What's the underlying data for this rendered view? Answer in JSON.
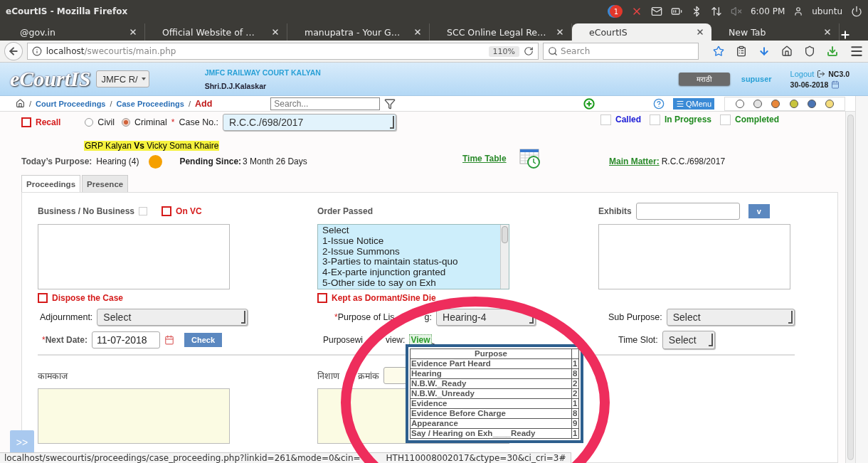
{
  "window": {
    "title": "eCourtIS - Mozilla Firefox"
  },
  "tray": {
    "notification_count": "1",
    "time": "6:00 PM",
    "user": "ubuntu"
  },
  "browser_tabs": [
    {
      "label": "@gov.in",
      "selected": false
    },
    {
      "label": "Official Website of …",
      "selected": false
    },
    {
      "label": "manupatra - Your G…",
      "selected": false
    },
    {
      "label": "SCC Online Legal Re…",
      "selected": false
    },
    {
      "label": "eCourtIS",
      "selected": true
    },
    {
      "label": "New Tab",
      "selected": false
    }
  ],
  "address_bar": {
    "host": "localhost",
    "path": "/swecourtis/main.php",
    "zoom": "110%"
  },
  "browser_search": {
    "placeholder": "Search"
  },
  "app_header": {
    "logo": "eCourtIS",
    "court_select": "JMFC R/",
    "court_name": "JMFC RAILWAY COURT KALYAN",
    "judge": "Shri.D.J.Kalaskar",
    "language_button": "मराठी",
    "user": "supuser",
    "logout": "Logout",
    "version": "NC3.0",
    "date": "30-06-2018"
  },
  "breadcrumb_separator": "/",
  "required_mark": "*",
  "breadcrumb": [
    {
      "label": "Court Proceedings",
      "kind": "link"
    },
    {
      "label": "Case Proceedings",
      "kind": "link"
    },
    {
      "label": "Add",
      "kind": "current"
    }
  ],
  "search": {
    "placeholder": "Search..."
  },
  "qmenu": "QMenu",
  "color_filters": [
    {
      "color": "#ffffff"
    },
    {
      "color": "#e2e2e2"
    },
    {
      "color": "#e8873a"
    },
    {
      "color": "#c8c43c"
    },
    {
      "color": "#4a74b4"
    },
    {
      "color": "#f4dc7c"
    }
  ],
  "case": {
    "recall": {
      "label": "Recall",
      "checked": false
    },
    "case_types": [
      {
        "label": "Civil",
        "selected": false
      },
      {
        "label": "Criminal",
        "selected": true
      }
    ],
    "case_no_label": "Case No.:",
    "case_no": "R.C.C./698/2017",
    "status_flags": [
      {
        "label": "Called",
        "checked": false,
        "color": "#1a1ad6"
      },
      {
        "label": "In Progress",
        "checked": false,
        "color": "#1f8a1f"
      },
      {
        "label": "Completed",
        "checked": false,
        "color": "#1f8a1f"
      }
    ],
    "parties": "GRP Kalyan **Vs** Vicky Soma Khaire",
    "todays_purpose_label": "Today’s Purpose:",
    "todays_purpose": "Hearing (4)",
    "pending_label": "Pending Since:",
    "pending": "3 Month 26 Days",
    "time_table": "Time Table",
    "main_matter_label": "Main Matter:",
    "main_matter": "R.C.C./698/2017"
  },
  "tabs": [
    {
      "label": "Proceedings",
      "selected": true
    },
    {
      "label": "Presence",
      "selected": false
    }
  ],
  "proceedings": {
    "business_label": "Business / No Business",
    "business_checked": false,
    "on_vc": {
      "label": "On VC",
      "checked": false
    },
    "order_passed_label": "Order Passed",
    "order_options": [
      "Select",
      "1-Issue Notice",
      "2-Issue Summons",
      "3-Parties to maintain status-quo",
      "4-Ex-parte injunction granted",
      "5-Other side to say on Exh"
    ],
    "exhibits_label": "Exhibits",
    "exhibits_button": "v",
    "dispose": {
      "label": "Dispose the Case",
      "checked": false
    },
    "dormant": {
      "label": "Kept as Dormant/Sine Die",
      "checked": false
    },
    "adjournment_label": "Adjournment:",
    "adjournment": "Select",
    "purpose_label": "Purpose of Lis",
    "purpose_label_tail": "g:",
    "purpose": "Hearing-4",
    "sub_purpose_label": "Sub Purpose:",
    "sub_purpose": "Select",
    "next_date_label": "Next Date:",
    "next_date": "11-07-2018",
    "check_button": "Check",
    "purposewise_label": "Purposewi",
    "purposewise_tail": "view:",
    "view_link": "View",
    "time_slot_label": "Time Slot:",
    "time_slot": "Select",
    "kamkaj_label": "कामकाज",
    "nishani_label": "निशाण",
    "nishani_tail": "क्रमांक"
  },
  "purpose_popup": {
    "header": "Purpose",
    "rows": [
      {
        "purpose": "Evidence Part Heard",
        "count": "1"
      },
      {
        "purpose": "Hearing",
        "count": "8"
      },
      {
        "purpose": "N.B.W._Ready",
        "count": "2"
      },
      {
        "purpose": "N.B.W._Unready",
        "count": "2"
      },
      {
        "purpose": "Evidence",
        "count": "1"
      },
      {
        "purpose": "Evidence Before Charge",
        "count": "8"
      },
      {
        "purpose": "Appearance",
        "count": "9"
      },
      {
        "purpose": "Say / Hearing on Exh____Ready",
        "count": "1"
      }
    ]
  },
  "collapse_button": ">>",
  "status_bar": {
    "url_start": "localhost/swecourtis/proceedings/case_proceeding.php?linkid=261&mode=0&cin=",
    "url_end": "HTH110008002017&ctype=30&ci_cri=3#"
  }
}
